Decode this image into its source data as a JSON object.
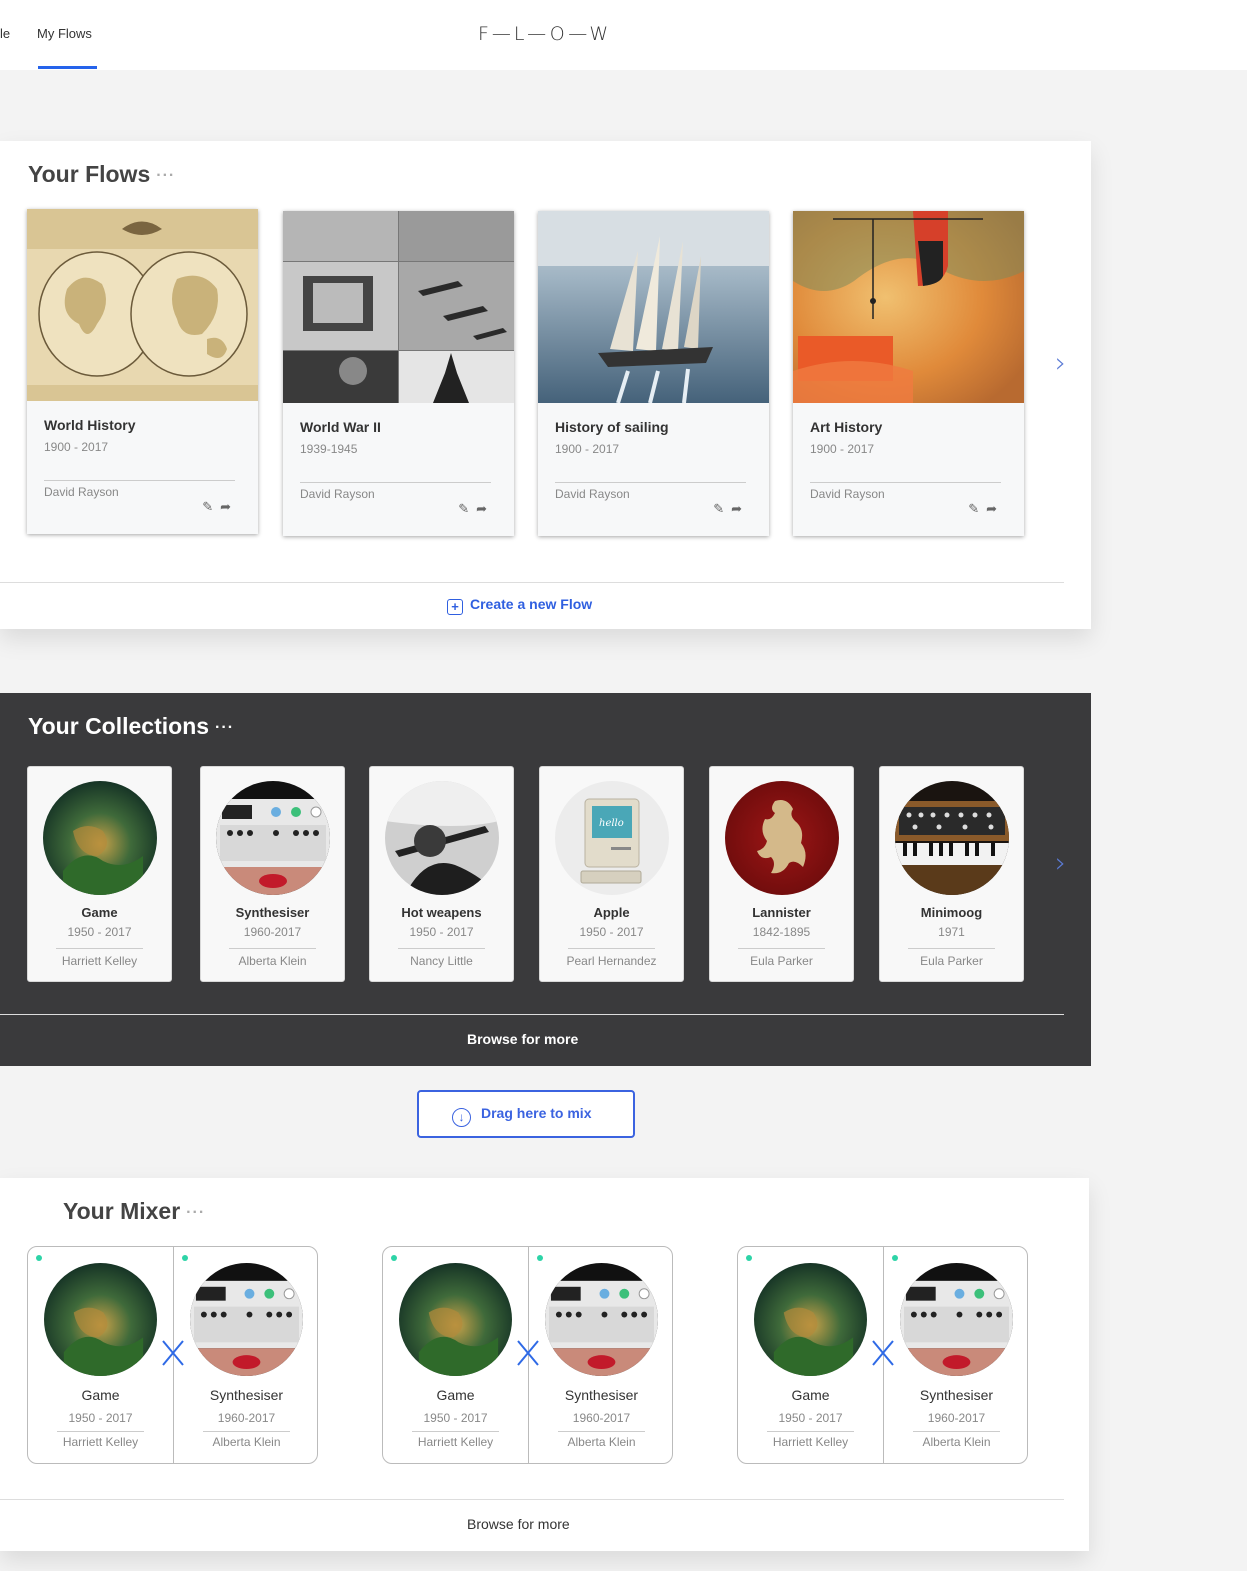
{
  "nav": {
    "prev_tab": "le",
    "active_tab": "My Flows",
    "logo": "F—L—O—W"
  },
  "flows": {
    "title": "Your Flows",
    "more": "···",
    "cards": [
      {
        "title": "World History",
        "dates": "1900 - 2017",
        "author": "David Rayson"
      },
      {
        "title": "World War II",
        "dates": "1939-1945",
        "author": "David Rayson"
      },
      {
        "title": "History of sailing",
        "dates": "1900 - 2017",
        "author": "David Rayson"
      },
      {
        "title": "Art History",
        "dates": "1900 - 2017",
        "author": "David Rayson"
      }
    ],
    "create_label": "Create a new Flow",
    "create_icon": "+"
  },
  "collections": {
    "title": "Your Collections",
    "more": "···",
    "cards": [
      {
        "title": "Game",
        "dates": "1950 - 2017",
        "author": "Harriett Kelley"
      },
      {
        "title": "Synthesiser",
        "dates": "1960-2017",
        "author": "Alberta Klein"
      },
      {
        "title": "Hot weapens",
        "dates": "1950 - 2017",
        "author": "Nancy Little"
      },
      {
        "title": "Apple",
        "dates": "1950 - 2017",
        "author": "Pearl Hernandez"
      },
      {
        "title": "Lannister",
        "dates": "1842-1895",
        "author": "Eula Parker"
      },
      {
        "title": "Minimoog",
        "dates": "1971",
        "author": "Eula Parker"
      }
    ],
    "browse_label": "Browse for more"
  },
  "drag": {
    "label": "Drag here to mix",
    "icon": "↓"
  },
  "mixer": {
    "title": "Your Mixer",
    "more": "···",
    "pairs": [
      {
        "left": {
          "title": "Game",
          "dates": "1950 - 2017",
          "author": "Harriett Kelley"
        },
        "right": {
          "title": "Synthesiser",
          "dates": "1960-2017",
          "author": "Alberta Klein"
        }
      },
      {
        "left": {
          "title": "Game",
          "dates": "1950 - 2017",
          "author": "Harriett Kelley"
        },
        "right": {
          "title": "Synthesiser",
          "dates": "1960-2017",
          "author": "Alberta Klein"
        }
      },
      {
        "left": {
          "title": "Game",
          "dates": "1950 - 2017",
          "author": "Harriett Kelley"
        },
        "right": {
          "title": "Synthesiser",
          "dates": "1960-2017",
          "author": "Alberta Klein"
        }
      }
    ],
    "browse_label": "Browse for more"
  },
  "icons": {
    "next": "chevron-right-icon",
    "edit": "pencil-icon",
    "share": "share-arrow-icon"
  },
  "colors": {
    "accent": "#2f5fe0",
    "dark_panel": "#3a3a3c",
    "status_dot": "#2dd4a7"
  }
}
